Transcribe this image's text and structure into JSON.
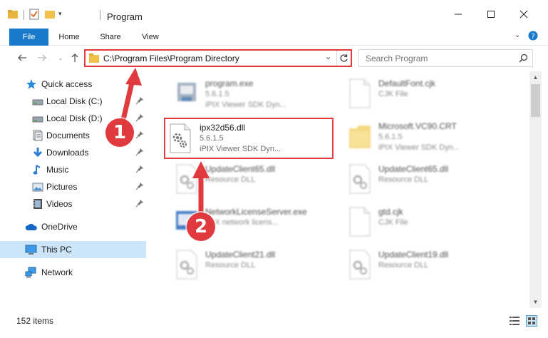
{
  "window": {
    "title": "Program",
    "colors": {
      "accent": "#1979ca",
      "annotation": "#e0393e",
      "selected": "#cce4f7"
    }
  },
  "ribbon": {
    "tabs": [
      {
        "label": "File"
      },
      {
        "label": "Home"
      },
      {
        "label": "Share"
      },
      {
        "label": "View"
      }
    ]
  },
  "nav": {
    "address": "C:\\Program Files\\Program Directory",
    "search_placeholder": "Search Program"
  },
  "sidebar": {
    "items": [
      {
        "label": "Quick access",
        "icon": "star-icon"
      },
      {
        "label": "Local Disk (C:)",
        "icon": "drive-icon",
        "pinned": true
      },
      {
        "label": "Local Disk (D:)",
        "icon": "drive-icon",
        "pinned": true
      },
      {
        "label": "Documents",
        "icon": "documents-icon",
        "pinned": true
      },
      {
        "label": "Downloads",
        "icon": "downloads-icon",
        "pinned": true
      },
      {
        "label": "Music",
        "icon": "music-icon",
        "pinned": true
      },
      {
        "label": "Pictures",
        "icon": "pictures-icon",
        "pinned": true
      },
      {
        "label": "Videos",
        "icon": "videos-icon",
        "pinned": true
      },
      {
        "label": "OneDrive",
        "icon": "onedrive-icon"
      },
      {
        "label": "This PC",
        "icon": "pc-icon",
        "selected": true
      },
      {
        "label": "Network",
        "icon": "network-icon"
      }
    ]
  },
  "files": [
    {
      "name": "program.exe",
      "line2": "5.6.1.5",
      "line3": "iPIX Viewer SDK Dyn...",
      "icon": "exe-icon"
    },
    {
      "name": "DefaultFont.cjk",
      "line2": "CJK File",
      "line3": "",
      "icon": "file-icon"
    },
    {
      "name": "ipx32d56.dll",
      "line2": "5.6.1.5",
      "line3": "iPIX Viewer SDK Dyn...",
      "icon": "dll-gear-icon"
    },
    {
      "name": "Microsoft.VC90.CRT",
      "line2": "5.6.1.5",
      "line3": "iPIX Viewer SDK Dyn...",
      "icon": "folder-icon"
    },
    {
      "name": "UpdateClient65.dll",
      "line2": "Resource DLL",
      "line3": "",
      "icon": "dll-icon"
    },
    {
      "name": "UpdateClient65.dll",
      "line2": "Resource DLL",
      "line3": "",
      "icon": "dll-icon"
    },
    {
      "name": "NetworkLicenseServer.exe",
      "line2": "IPIX network licens...",
      "line3": "",
      "icon": "exe-icon"
    },
    {
      "name": "gtd.cjk",
      "line2": "CJK File",
      "line3": "",
      "icon": "file-icon"
    },
    {
      "name": "UpdateClient21.dll",
      "line2": "Resource DLL",
      "line3": "",
      "icon": "dll-icon"
    },
    {
      "name": "UpdateClient19.dll",
      "line2": "Resource DLL",
      "line3": "",
      "icon": "dll-icon"
    }
  ],
  "status": {
    "item_count": "152 items"
  },
  "annotations": {
    "step1": "1",
    "step2": "2"
  }
}
